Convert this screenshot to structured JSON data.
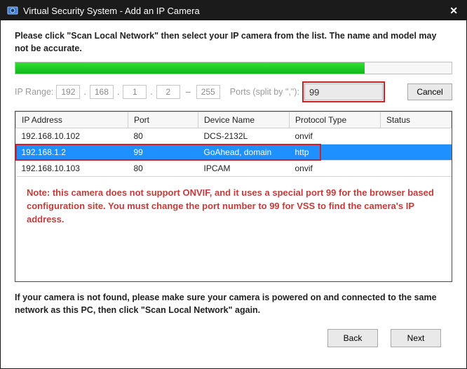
{
  "window": {
    "title": "Virtual Security System - Add an IP Camera"
  },
  "instruction": "Please click \"Scan Local Network\" then select your IP camera from the list. The name and model may not be accurate.",
  "ip_range": {
    "label": "IP Range:",
    "oct1": "192",
    "oct2": "168",
    "oct3": "1",
    "oct4": "2",
    "end": "255"
  },
  "ports": {
    "label": "Ports (split by \",\"):",
    "value": "99"
  },
  "cancel": "Cancel",
  "table": {
    "headers": {
      "ip": "IP Address",
      "port": "Port",
      "device": "Device Name",
      "protocol": "Protocol Type",
      "status": "Status"
    },
    "row0": {
      "ip": "192.168.10.102",
      "port": "80",
      "device": "DCS-2132L",
      "protocol": "onvif",
      "status": ""
    },
    "row1": {
      "ip": "192.168.1.2",
      "port": "99",
      "device": "GoAhead, domain",
      "protocol": "http",
      "status": ""
    },
    "row2": {
      "ip": "192.168.10.103",
      "port": "80",
      "device": "IPCAM",
      "protocol": "onvif",
      "status": ""
    }
  },
  "note": "Note: this camera does not support ONVIF, and it uses a special port 99 for the browser based configuration site. You must change the port number to 99 for VSS to find the camera's IP address.",
  "footer_text": "If your camera is not found, please make sure your camera is powered on and connected to the same network as this PC, then click \"Scan Local Network\" again.",
  "buttons": {
    "back": "Back",
    "next": "Next"
  },
  "progress_percent": 80
}
